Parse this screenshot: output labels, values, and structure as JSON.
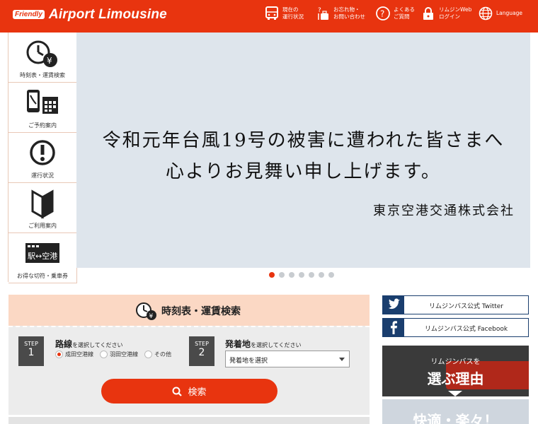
{
  "header": {
    "badge": "Friendly",
    "brand": "Airport Limousine",
    "nav": [
      {
        "label": "現在の\n運行状況",
        "icon": "bus-icon"
      },
      {
        "label": "お忘れ物・\nお問い合わせ",
        "icon": "lost-item-icon"
      },
      {
        "label": "よくある\nご質問",
        "icon": "question-icon"
      },
      {
        "label": "リムジンWeb\nログイン",
        "icon": "lock-icon"
      },
      {
        "label": "Language",
        "icon": "globe-icon"
      }
    ]
  },
  "sidebar": {
    "items": [
      {
        "label": "時刻表・運賃検索",
        "icon": "clock-yen-icon"
      },
      {
        "label": "ご予約案内",
        "icon": "phone-calendar-icon"
      },
      {
        "label": "運行状況",
        "icon": "exclamation-icon"
      },
      {
        "label": "ご利用案内",
        "icon": "beginner-mark-icon"
      },
      {
        "label": "お得な切符・乗車券",
        "icon": "ticket-icon",
        "ticket_text": "駅↔空港"
      }
    ]
  },
  "hero": {
    "line1": "令和元年台風19号の被害に遭われた皆さまへ",
    "line2": "心よりお見舞い申し上げます。",
    "signature": "東京空港交通株式会社",
    "slide_count": 7,
    "active_slide": 0
  },
  "search": {
    "title": "時刻表・運賃検索",
    "step1": {
      "step": "STEP",
      "num": "1",
      "title": "路線",
      "sub": "を選択してください",
      "options": [
        "成田空港線",
        "羽田空港線",
        "その他"
      ],
      "selected": 0
    },
    "step2": {
      "step": "STEP",
      "num": "2",
      "title": "発着地",
      "sub": "を選択してください",
      "select_value": "発着地を選択"
    },
    "button": "検索"
  },
  "social": {
    "twitter": "リムジンバス公式 Twitter",
    "facebook": "リムジンバス公式 Facebook"
  },
  "banners": {
    "b1_sub": "リムジンバスを",
    "b1_main": "選ぶ理由",
    "b2_main": "快適・楽々！"
  },
  "colors": {
    "accent": "#e8340f",
    "social": "#1a3e6e",
    "panel_head": "#fbd8c4"
  }
}
